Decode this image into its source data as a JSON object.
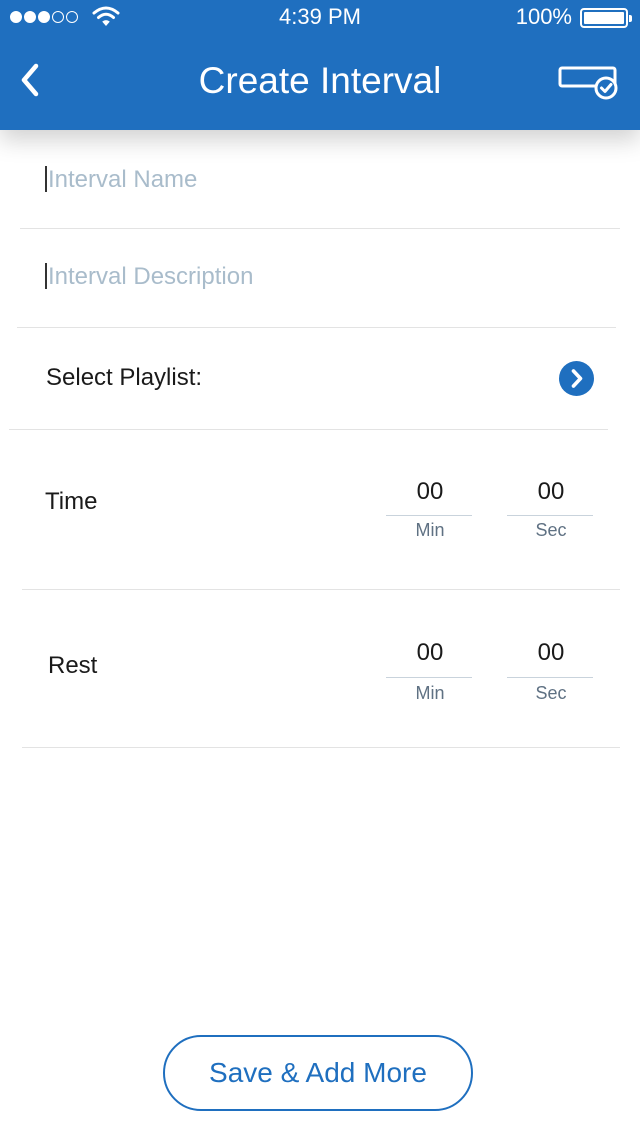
{
  "status_bar": {
    "time": "4:39 PM",
    "battery": "100%",
    "signal_filled_dots": 3,
    "signal_total_dots": 5
  },
  "header": {
    "title": "Create Interval",
    "back_icon": "chevron-left-icon",
    "save_icon": "save-check-icon",
    "background_color": "#1f6fbf"
  },
  "form": {
    "interval_name_placeholder": "Interval Name",
    "interval_description_placeholder": "Interval Description",
    "select_playlist_label": "Select Playlist:",
    "time": {
      "label": "Time",
      "min_value": "00",
      "min_label": "Min",
      "sec_value": "00",
      "sec_label": "Sec"
    },
    "rest": {
      "label": "Rest",
      "min_value": "00",
      "min_label": "Min",
      "sec_value": "00",
      "sec_label": "Sec"
    }
  },
  "footer": {
    "save_add_more_label": "Save & Add More"
  },
  "colors": {
    "accent": "#1f6fbf",
    "placeholder": "#a9bccb"
  }
}
